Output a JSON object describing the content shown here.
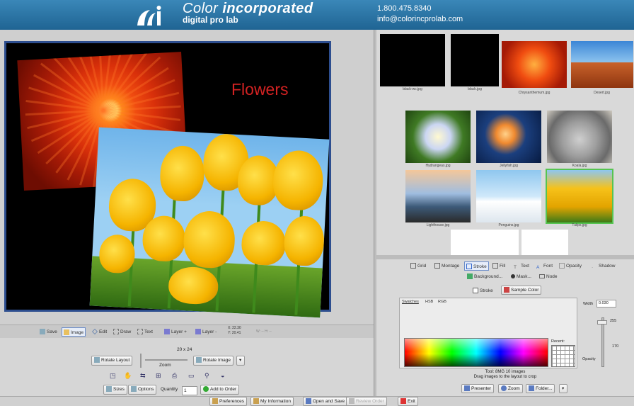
{
  "header": {
    "brand_light": "Color ",
    "brand_bold": "incorporated",
    "sub": "digital pro lab",
    "phone": "1.800.475.8340",
    "email": "info@colorincprolab.com",
    "bg_color": "#2a76a8"
  },
  "canvas": {
    "caption": "Flowers",
    "caption_color": "#d22222",
    "frame_color": "#2d4e8f"
  },
  "toolbar": {
    "save": "Save",
    "image": "Image",
    "edit": "Edit",
    "draw": "Draw",
    "text": "Text",
    "layer_plus": "Layer +",
    "layer_minus": "Layer -",
    "coords1": "X: 22.30",
    "coords2": "Y: 20.41",
    "coords3": "W: --  H: --"
  },
  "controls": {
    "size_label": "20 x 24",
    "zoom_label": "Zoom",
    "rotate_layout": "Rotate Layout",
    "rotate_image": "Rotate Image",
    "sizes": "Sizes",
    "options": "Options",
    "quantity_label": "Quantity",
    "quantity_value": "1",
    "add_to_order": "Add to Order"
  },
  "footer": {
    "preferences": "Preferences",
    "my_information": "My Information",
    "open_and_save": "Open and Save",
    "review_order": "Review Order",
    "exit": "Exit"
  },
  "thumbnails": [
    {
      "name": "black-wc.jpg",
      "icon": "black-image"
    },
    {
      "name": "black.jpg",
      "icon": "black-image"
    },
    {
      "name": "Chrysanthemum.jpg",
      "icon": "flower-image"
    },
    {
      "name": "Desert.jpg",
      "icon": "desert-image"
    },
    {
      "name": "Hydrangeas.jpg",
      "icon": "hydrangea-image"
    },
    {
      "name": "Jellyfish.jpg",
      "icon": "jellyfish-image"
    },
    {
      "name": "Koala.jpg",
      "icon": "koala-image"
    },
    {
      "name": "Lighthouse.jpg",
      "icon": "lighthouse-image"
    },
    {
      "name": "Penguins.jpg",
      "icon": "penguins-image"
    },
    {
      "name": "Tulips.jpg",
      "icon": "tulips-image",
      "selected": true
    }
  ],
  "props": {
    "tabs": [
      "Grid",
      "Montage",
      "Stroke",
      "Fill",
      "Text",
      "Font",
      "Opacity",
      "Shadow"
    ],
    "selected_tab": "Stroke",
    "options": [
      "Background...",
      "Mask...",
      "Node"
    ],
    "stroke_checkbox": "Stroke",
    "sample_color": "Sample Color",
    "swatch_tabs": [
      "Swatches",
      "HSB",
      "RGB"
    ],
    "width_label": "Width",
    "width_value": "0.030",
    "recent_label": "Recent:",
    "opacity_label": "Opacity",
    "scale_top": "255",
    "scale_mid": "170",
    "info1": "Tool: 8MG  10 images",
    "info2": "Drag images to the layout to crop",
    "presenter": "Presenter",
    "zoom": "Zoom",
    "folder": "Folder..."
  }
}
